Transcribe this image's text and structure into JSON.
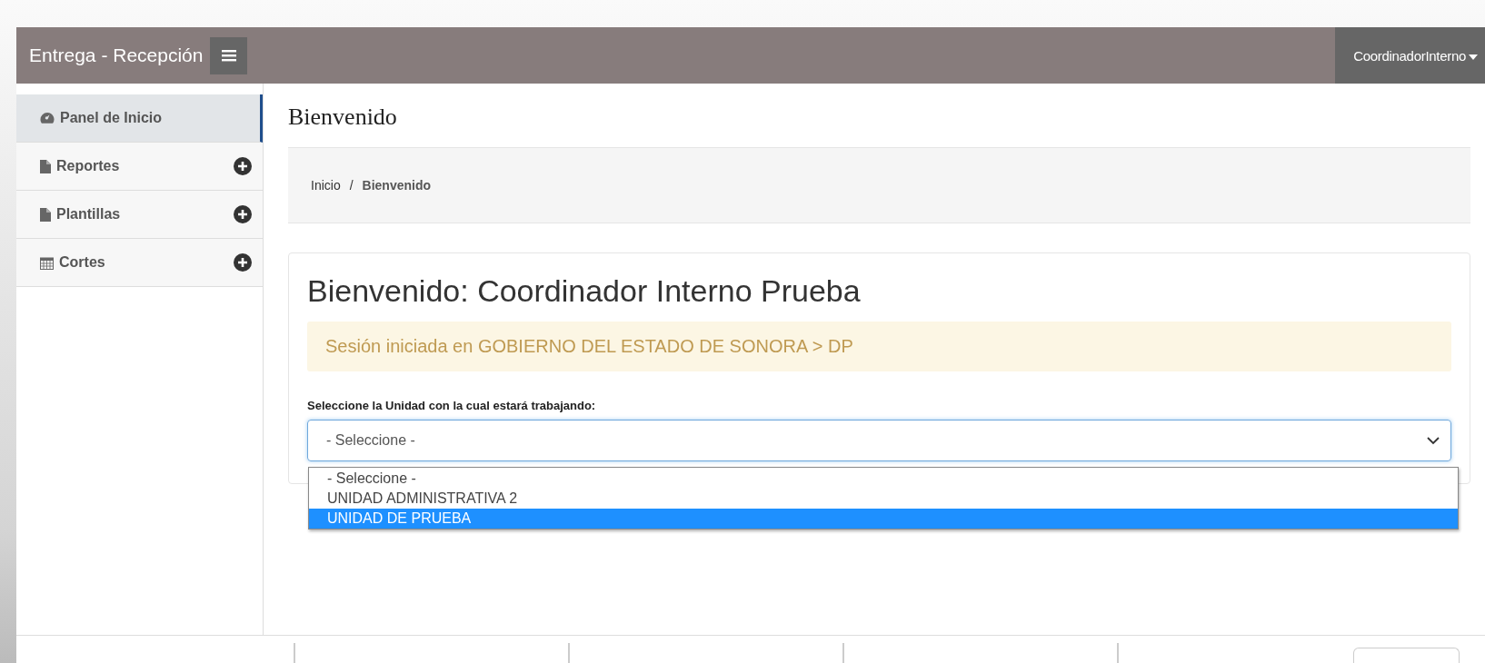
{
  "header": {
    "brand": "Entrega - Recepción",
    "user_menu": "CoordinadorInterno"
  },
  "sidebar": {
    "items": [
      {
        "label": "Panel de Inicio",
        "selected": true,
        "expandable": false
      },
      {
        "label": "Reportes",
        "selected": false,
        "expandable": true
      },
      {
        "label": "Plantillas",
        "selected": false,
        "expandable": true
      },
      {
        "label": "Cortes",
        "selected": false,
        "expandable": true
      }
    ]
  },
  "page_title": "Bienvenido",
  "breadcrumb": {
    "separator": "/",
    "items": [
      "Inicio",
      "Bienvenido"
    ]
  },
  "card": {
    "heading": "Bienvenido: Coordinador Interno Prueba",
    "alert": "Sesión iniciada en GOBIERNO DEL ESTADO DE SONORA > DP",
    "select_label": "Seleccione la Unidad con la cual estará trabajando:",
    "select_value": "- Seleccione -",
    "options": [
      {
        "label": "- Seleccione -",
        "selected": false
      },
      {
        "label": "UNIDAD ADMINISTRATIVA 2",
        "selected": false
      },
      {
        "label": "UNIDAD DE PRUEBA",
        "selected": true
      }
    ]
  }
}
